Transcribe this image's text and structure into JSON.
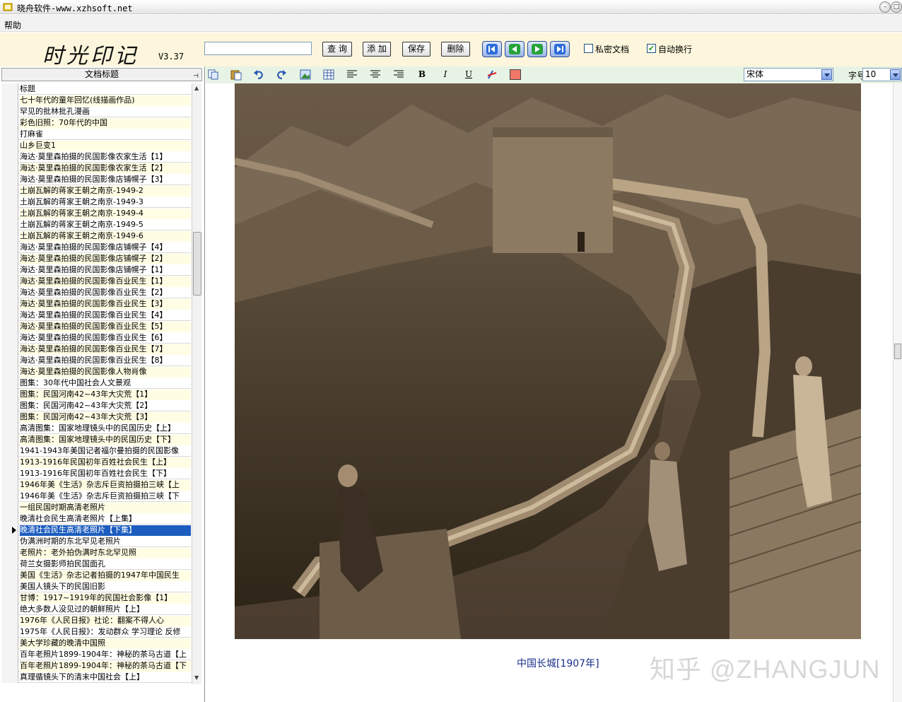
{
  "window": {
    "title": "晓舟软件-www.xzhsoft.net"
  },
  "menu": {
    "help": "帮助"
  },
  "toolbar": {
    "logo": "时光印记",
    "version": "V3.37",
    "search_value": "",
    "buttons": {
      "query": "查 询",
      "add": "添 加",
      "save": "保存",
      "delete": "删除"
    },
    "private_doc": {
      "label": "私密文档",
      "checked": false
    },
    "auto_wrap": {
      "label": "自动换行",
      "checked": true
    }
  },
  "doc_panel": {
    "header": "文档标题",
    "rows": [
      "标题",
      "七十年代的童年回忆(线描画作品)",
      "罕见的批林批孔漫画",
      "彩色旧照：70年代的中国",
      "打麻雀",
      "山乡巨变1",
      "海达·莫里森拍摄的民国影像农家生活【1】",
      "海达·莫里森拍摄的民国影像农家生活【2】",
      "海达·莫里森拍摄的民国影像店铺幌子【3】",
      "土崩瓦解的蒋家王朝之南京-1949-2",
      "土崩瓦解的蒋家王朝之南京-1949-3",
      "土崩瓦解的蒋家王朝之南京-1949-4",
      "土崩瓦解的蒋家王朝之南京-1949-5",
      "土崩瓦解的蒋家王朝之南京-1949-6",
      "海达·莫里森拍摄的民国影像店铺幌子【4】",
      "海达·莫里森拍摄的民国影像店铺幌子【2】",
      "海达·莫里森拍摄的民国影像店铺幌子【1】",
      "海达·莫里森拍摄的民国影像百业民生【1】",
      "海达·莫里森拍摄的民国影像百业民生【2】",
      "海达·莫里森拍摄的民国影像百业民生【3】",
      "海达·莫里森拍摄的民国影像百业民生【4】",
      "海达·莫里森拍摄的民国影像百业民生【5】",
      "海达·莫里森拍摄的民国影像百业民生【6】",
      "海达·莫里森拍摄的民国影像百业民生【7】",
      "海达·莫里森拍摄的民国影像百业民生【8】",
      "海达·莫里森拍摄的民国影像人物肖像",
      "图集：30年代中国社会人文景观",
      "图集：民国河南42~43年大灾荒【1】",
      "图集：民国河南42~43年大灾荒【2】",
      "图集：民国河南42~43年大灾荒【3】",
      "高清图集：国家地理镜头中的民国历史【上】",
      "高清图集：国家地理镜头中的民国历史【下】",
      "1941-1943年美国记者福尔曼拍摄的民国影像",
      "1913-1916年民国初年百姓社会民生【上】",
      "1913-1916年民国初年百姓社会民生【下】",
      "1946年美《生活》杂志斥巨资拍摄拍三峡【上",
      "1946年美《生活》杂志斥巨资拍摄拍三峡【下",
      "一组民国时期高清老照片",
      "晚清社会民生高清老照片【上集】",
      "晚清社会民生高清老照片【下集】",
      "伪满洲时期的东北罕见老照片",
      "老照片：老外拍伪满时东北罕见照",
      "荷兰女摄影师拍民国面孔",
      "美国《生活》杂志记者拍摄的1947年中国民生",
      "美国人镜头下的民国旧影",
      "甘博：1917~1919年的民国社会影像【1】",
      "绝大多数人没见过的朝鲜照片【上】",
      "1976年《人民日报》社论：翻案不得人心",
      "1975年《人民日报》：发动群众 学习理论 反修",
      "美大学珍藏的晚清中国照",
      "百年老照片1899-1904年：神秘的茶马古道【上",
      "百年老照片1899-1904年：神秘的茶马古道【下",
      "真理循镜头下的清末中国社会【上】"
    ],
    "selected_index": 39
  },
  "format_bar": {
    "font": "宋体",
    "size_label": "字号",
    "size": "10"
  },
  "document": {
    "caption": "中国长城[1907年]",
    "watermark": "知乎 @ZHANGJUN"
  }
}
